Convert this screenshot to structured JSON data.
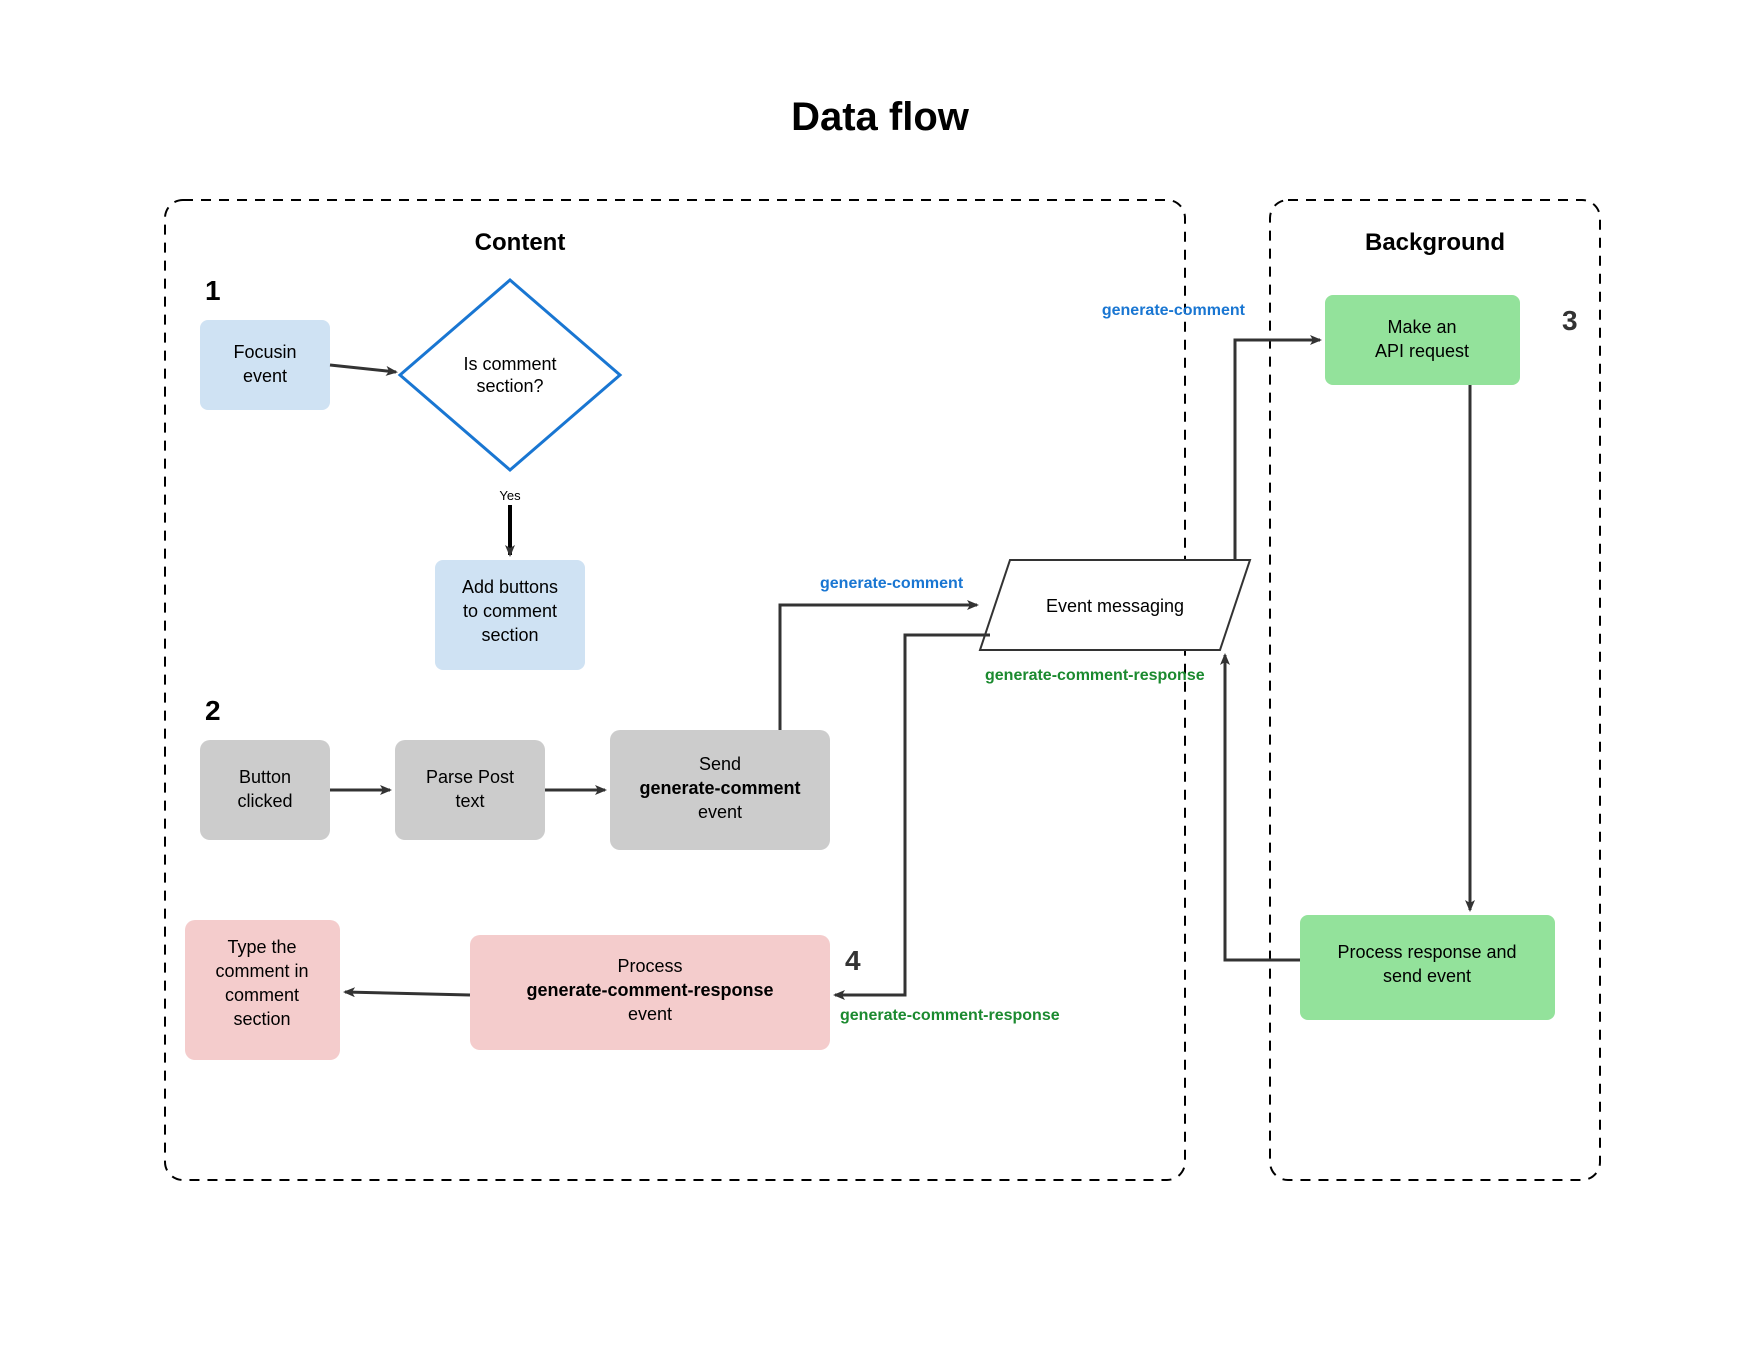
{
  "title": "Data flow",
  "sections": {
    "content": "Content",
    "background": "Background"
  },
  "steps": {
    "s1": "1",
    "s2": "2",
    "s3": "3",
    "s4": "4"
  },
  "nodes": {
    "focusin": {
      "l1": "Focusin",
      "l2": "event"
    },
    "decision": {
      "l1": "Is comment",
      "l2": "section?"
    },
    "yes": "Yes",
    "addButtons": {
      "l1": "Add buttons",
      "l2": "to comment",
      "l3": "section"
    },
    "buttonClicked": {
      "l1": "Button",
      "l2": "clicked"
    },
    "parsePost": {
      "l1": "Parse Post",
      "l2": "text"
    },
    "sendEvent": {
      "l1": "Send",
      "l2": "generate-comment",
      "l3": "event"
    },
    "eventMessaging": "Event messaging",
    "makeApi": {
      "l1": "Make an",
      "l2": "API request"
    },
    "processResp": {
      "l1": "Process response and",
      "l2": "send event"
    },
    "processEvent": {
      "l1": "Process",
      "l2": "generate-comment-response",
      "l3": "event"
    },
    "typeComment": {
      "l1": "Type the",
      "l2": "comment in",
      "l3": "comment",
      "l4": "section"
    }
  },
  "edgeLabels": {
    "genCommentTop": "generate-comment",
    "genCommentRight": "generate-comment",
    "genCommentResponseMid": "generate-comment-response",
    "genCommentResponseBottom": "generate-comment-response"
  },
  "colors": {
    "blueFill": "#cfe2f3",
    "blueStroke": "#1976d2",
    "grayFill": "#cccccc",
    "pinkFill": "#f4cccc",
    "greenFill": "#93e29b",
    "arrow": "#333333",
    "dash": "#000000"
  }
}
